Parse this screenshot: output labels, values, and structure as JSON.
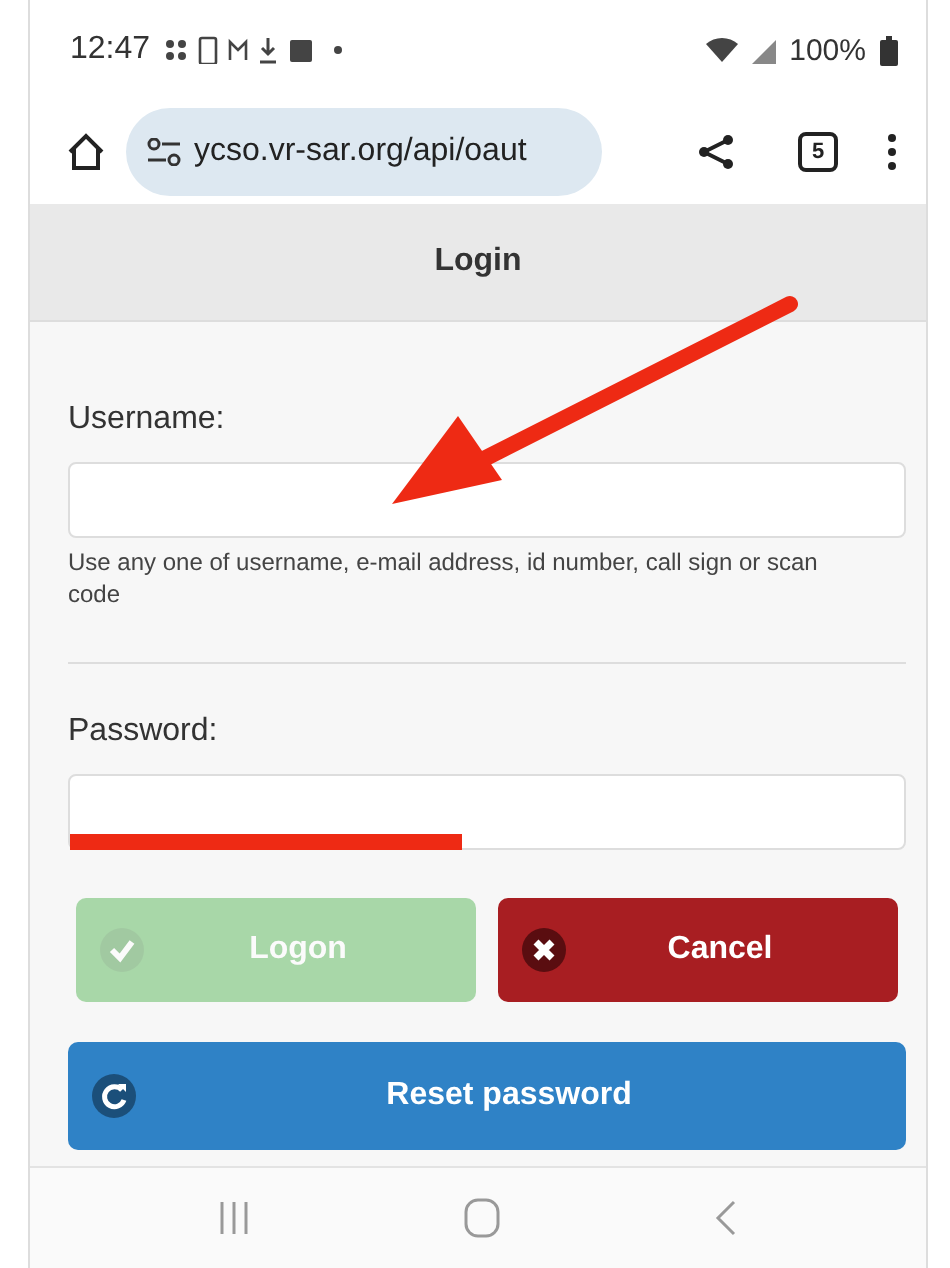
{
  "status_bar": {
    "time": "12:47",
    "battery": "100%"
  },
  "browser": {
    "url": "ycso.vr-sar.org/api/oaut",
    "tab_count": "5"
  },
  "header": {
    "title": "Login"
  },
  "form": {
    "fields": [
      {
        "label": "Username:",
        "hint": "Use any one of username, e-mail address, id number, call sign or scan code"
      },
      {
        "label": "Password:"
      }
    ],
    "buttons": [
      {
        "label": "Logon",
        "kind": "success",
        "disabled": true
      },
      {
        "label": "Cancel",
        "kind": "danger",
        "disabled": false
      }
    ],
    "reset_button": {
      "label": "Reset password",
      "kind": "primary",
      "disabled": false
    }
  }
}
